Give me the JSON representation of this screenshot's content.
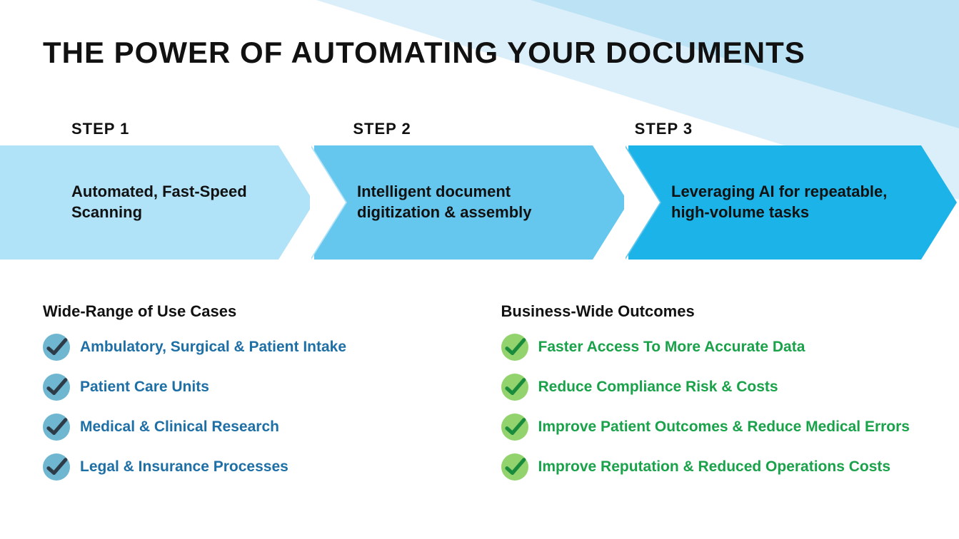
{
  "title": "THE POWER OF AUTOMATING YOUR DOCUMENTS",
  "steps": [
    {
      "label": "STEP 1",
      "text": "Automated, Fast-Speed Scanning"
    },
    {
      "label": "STEP 2",
      "text": "Intelligent document digitization & assembly"
    },
    {
      "label": "STEP 3",
      "text": "Leveraging AI for repeatable, high-volume tasks"
    }
  ],
  "col_left": {
    "title": "Wide-Range of Use Cases",
    "items": [
      "Ambulatory, Surgical & Patient Intake",
      "Patient Care Units",
      "Medical & Clinical Research",
      "Legal & Insurance Processes"
    ]
  },
  "col_right": {
    "title": "Business-Wide Outcomes",
    "items": [
      "Faster Access To More Accurate Data",
      "Reduce Compliance Risk & Costs",
      "Improve Patient Outcomes & Reduce Medical Errors",
      "Improve Reputation & Reduced Operations Costs"
    ]
  }
}
